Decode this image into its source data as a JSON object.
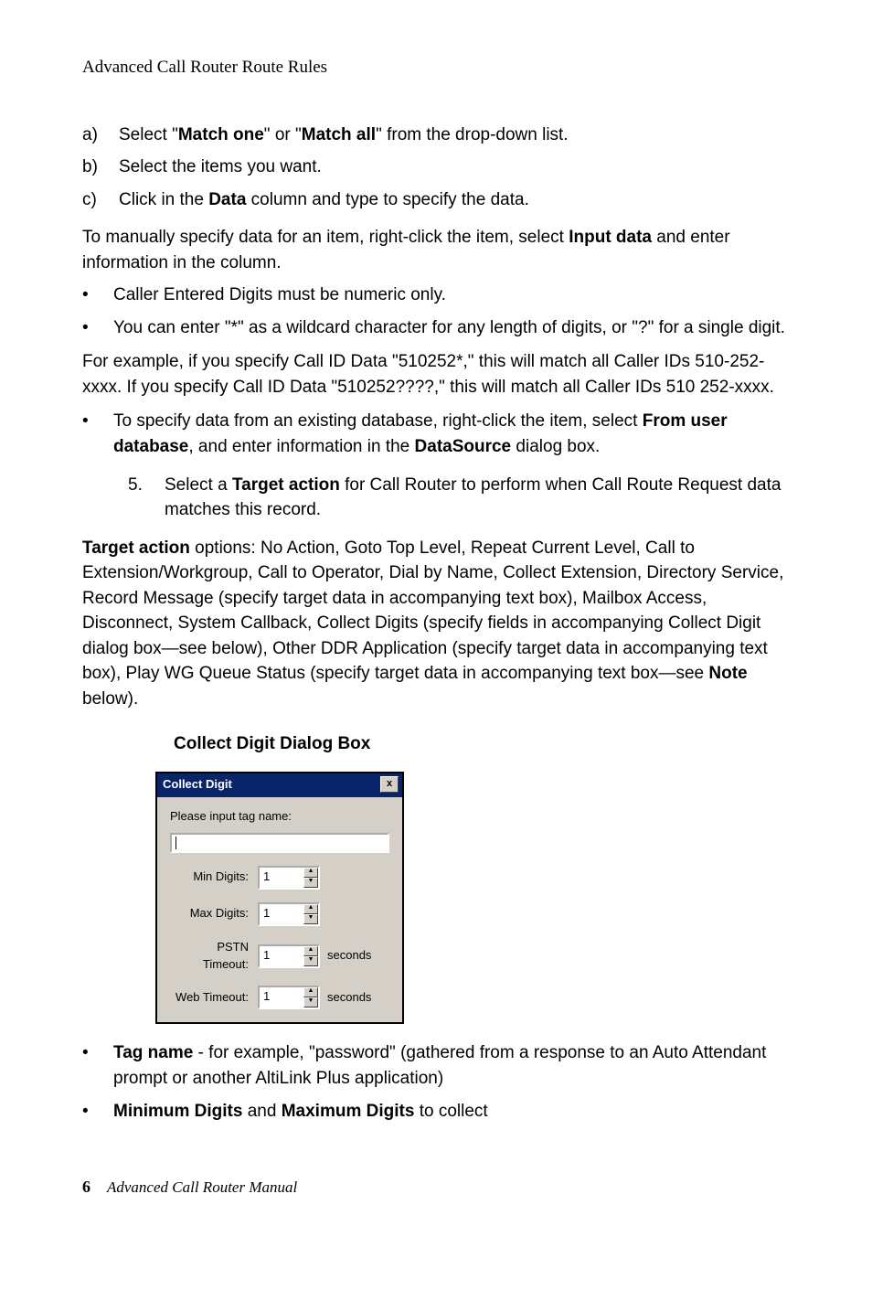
{
  "header": "Advanced Call Router Route Rules",
  "list_a": {
    "marker": "a)",
    "pre": " Select \"",
    "b1": "Match one",
    "mid": "\" or \"",
    "b2": "Match all",
    "post": "\" from the drop-down list."
  },
  "list_b": {
    "marker": "b)",
    "text": "Select the items you want."
  },
  "list_c": {
    "marker": "c)",
    "pre": "Click in the ",
    "b1": "Data",
    "post": " column and type to specify the data."
  },
  "manual": {
    "pre": "To manually specify data for an item, right-click the item, select ",
    "b1": "Input data",
    "post": " and enter information in the column."
  },
  "bullet1": "Caller Entered Digits must be numeric only.",
  "bullet2": "You can enter \"*\" as a wildcard character for any length of digits, or \"?\" for a single digit.",
  "bullet2_example": "For example, if you specify Call ID Data \"510252*,\" this will match all Caller IDs 510-252-xxxx. If you specify Call ID Data \"510252????,\" this will match all Caller IDs 510 252-xxxx.",
  "bullet3": {
    "pre": "To specify data from an existing database, right-click the item, select ",
    "b1": "From user database",
    "mid": ", and enter information in the ",
    "b2": "DataSource",
    "post": " dialog box."
  },
  "step5": {
    "marker": "5.",
    "pre": "Select a ",
    "b1": "Target action",
    "post": " for Call Router to perform when Call Route Request data matches this record."
  },
  "target_action": {
    "b1": "Target action",
    "mid": " options: No Action, Goto Top Level, Repeat Current Level, Call to Extension/Workgroup, Call to Operator, Dial by Name, Collect Extension, Directory Service, Record Message (specify target data in accompanying text box), Mailbox Access, Disconnect, System Callback, Collect Digits (specify fields in accompanying Collect Digit dialog box—see below), Other DDR Application (specify target data in accompanying text box), Play WG Queue Status (specify target data in accompanying text box—see ",
    "b2": "Note",
    "post": " below)."
  },
  "collect_heading": "Collect Digit Dialog Box",
  "dialog": {
    "title": "Collect Digit",
    "close": "x",
    "tag_label": "Please input tag name:",
    "rows": [
      {
        "label": "Min Digits:",
        "value": "1",
        "suffix": ""
      },
      {
        "label": "Max Digits:",
        "value": "1",
        "suffix": ""
      },
      {
        "label": "PSTN Timeout:",
        "value": "1",
        "suffix": "seconds"
      },
      {
        "label": "Web Timeout:",
        "value": "1",
        "suffix": "seconds"
      }
    ]
  },
  "post_bullets": {
    "b1": {
      "b": "Tag name",
      "text": " - for example, \"password\" (gathered from a response to an Auto Attendant prompt or another AltiLink Plus application)"
    },
    "b2": {
      "b1": "Minimum Digits",
      "mid": " and ",
      "b2": "Maximum Digits",
      "post": " to collect"
    }
  },
  "footer": {
    "page": "6",
    "title": "Advanced Call Router Manual"
  }
}
